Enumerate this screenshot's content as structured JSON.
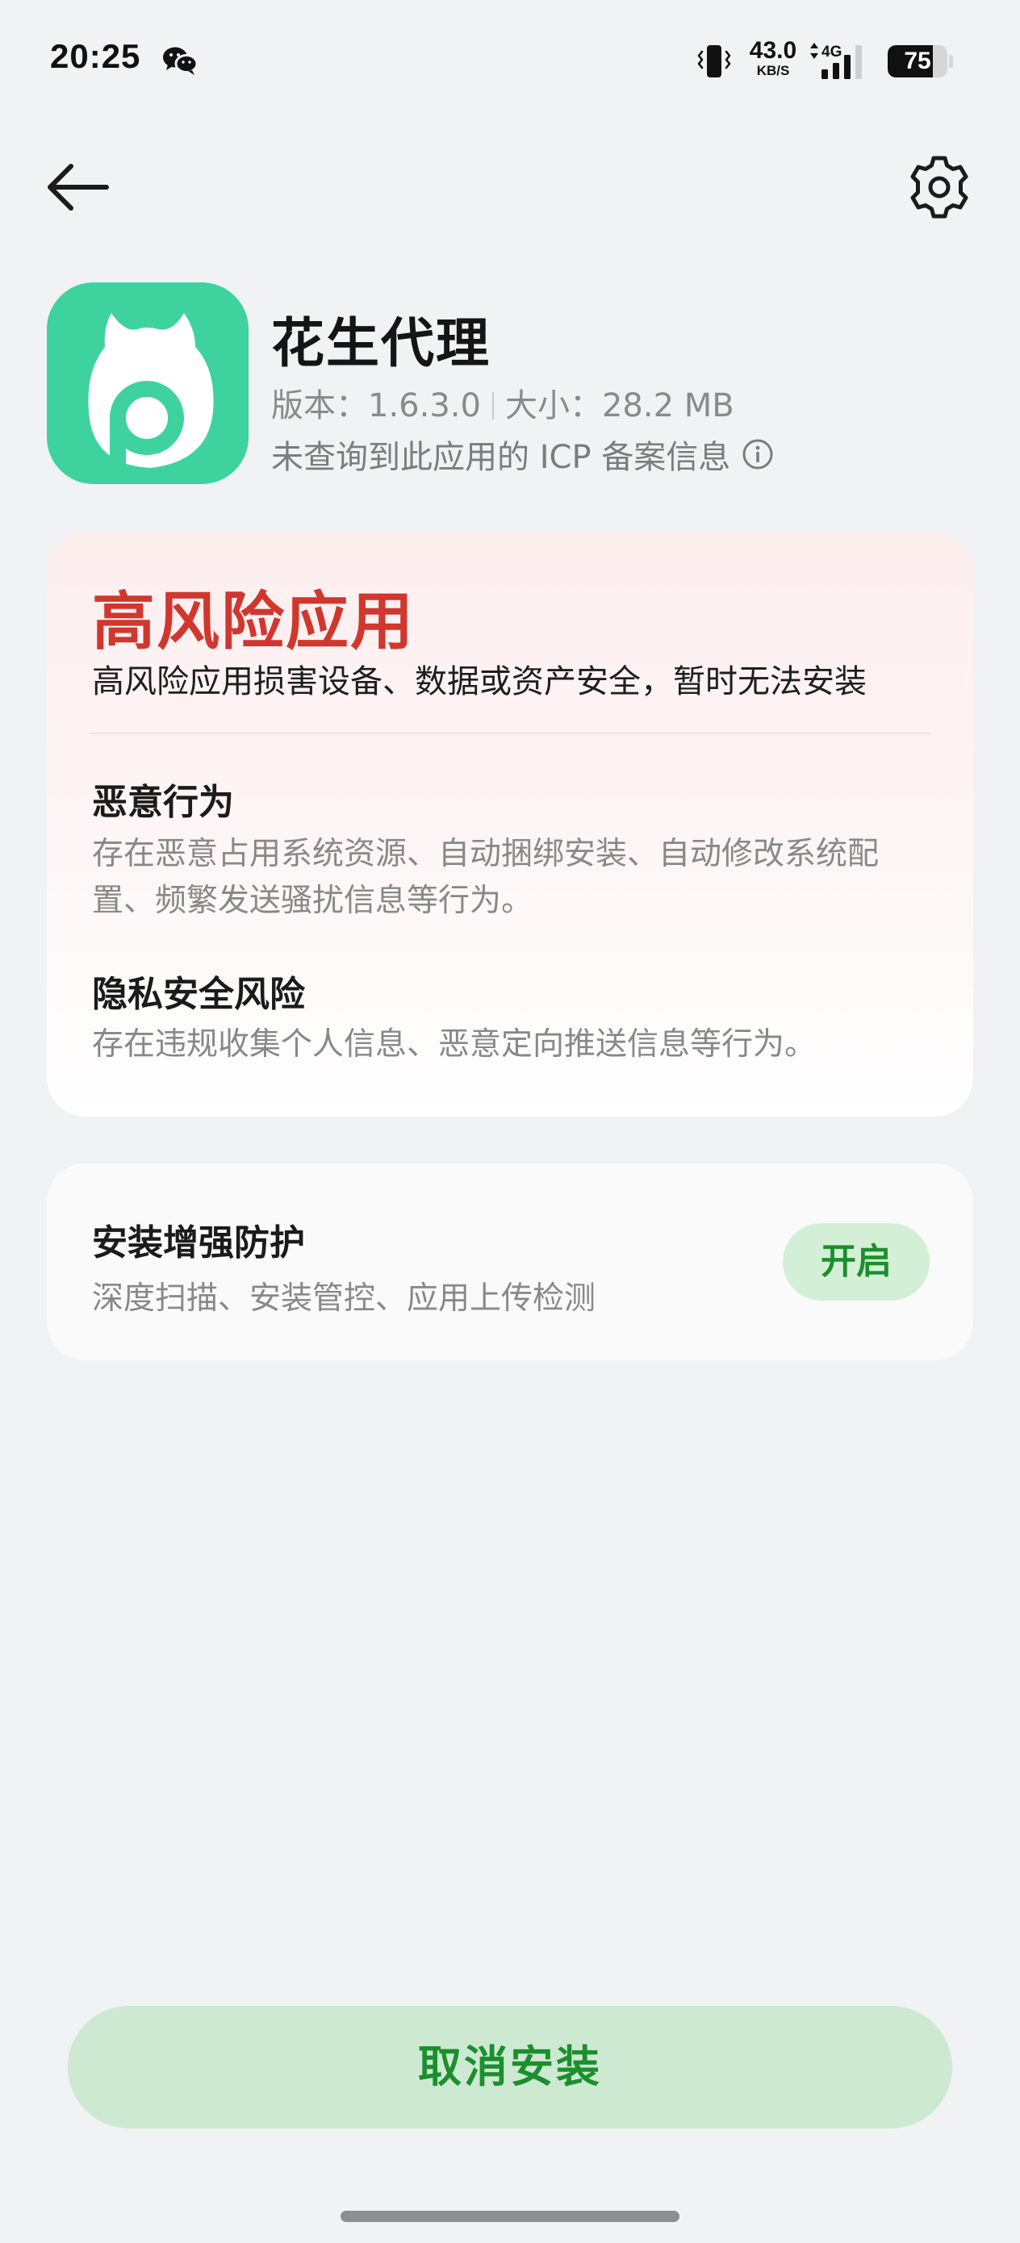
{
  "status_bar": {
    "time": "20:25",
    "net_speed_value": "43.0",
    "net_speed_unit": "KB/S",
    "network_type": "4G",
    "battery_level": "75",
    "battery_fraction": 0.75,
    "icons": [
      "wechat-icon",
      "vibrate-icon",
      "signal-icon",
      "battery-icon"
    ]
  },
  "toolbar": {
    "back_icon": "arrow-left-icon",
    "settings_icon": "gear-icon"
  },
  "app": {
    "name": "花生代理",
    "version_label": "版本：1.6.3.0",
    "size_label": "大小：28.2 MB",
    "icp_text": "未查询到此应用的 ICP 备案信息",
    "icon_color": "#3ed39e"
  },
  "risk": {
    "title": "高风险应用",
    "subtitle": "高风险应用损害设备、数据或资产安全，暂时无法安装",
    "title_color": "#d0372f",
    "items": [
      {
        "title": "恶意行为",
        "description": "存在恶意占用系统资源、自动捆绑安装、自动修改系统配置、频繁发送骚扰信息等行为。"
      },
      {
        "title": "隐私安全风险",
        "description": "存在违规收集个人信息、恶意定向推送信息等行为。"
      }
    ]
  },
  "protection": {
    "title": "安装增强防护",
    "description": "深度扫描、安装管控、应用上传检测",
    "button_label": "开启"
  },
  "actions": {
    "cancel_label": "取消安装",
    "accent_color": "#1b8f2d"
  }
}
